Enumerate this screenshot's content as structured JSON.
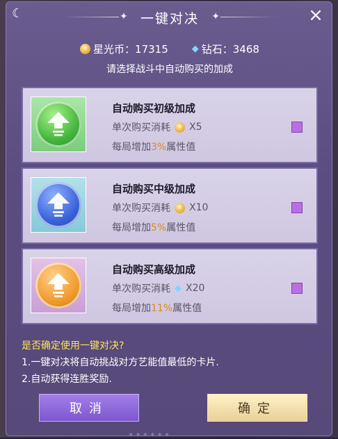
{
  "dialog": {
    "title": "一键对决",
    "close_label": "×",
    "moon_glyph": "☾",
    "sparkle": "✦"
  },
  "currency": {
    "starcoin_label": "星光币：17315",
    "diamond_label": "钻石：3468",
    "coin_icon": "coin-icon",
    "diamond_icon": "diamond-icon"
  },
  "hint": "请选择战斗中自动购买的加成",
  "options": [
    {
      "title": "自动购买初级加成",
      "cost_prefix": "单次购买消耗",
      "cost_currency": "coin-icon",
      "cost_amount": "X5",
      "bonus_prefix": "每局增加",
      "bonus_pct": "3%",
      "bonus_suffix": "属性值",
      "color": "#43b53b"
    },
    {
      "title": "自动购买中级加成",
      "cost_prefix": "单次购买消耗",
      "cost_currency": "coin-icon",
      "cost_amount": "X10",
      "bonus_prefix": "每局增加",
      "bonus_pct": "5%",
      "bonus_suffix": "属性值",
      "color": "#3a62d8"
    },
    {
      "title": "自动购买高级加成",
      "cost_prefix": "单次购买消耗",
      "cost_currency": "diamond-icon",
      "cost_amount": "X20",
      "bonus_prefix": "每局增加",
      "bonus_pct": "11%",
      "bonus_suffix": "属性值",
      "color": "#f09a2e"
    }
  ],
  "confirm": {
    "question": "是否确定使用一键对决?",
    "rule1": "1.一键对决将自动挑战对方艺能值最低的卡片.",
    "rule2": "2.自动获得连胜奖励."
  },
  "buttons": {
    "cancel": "取消",
    "ok": "确定"
  },
  "colors": {
    "accent_purple": "#b86fe0",
    "highlight_yellow": "#ffe45a",
    "pct_orange": "#d58a1e"
  }
}
